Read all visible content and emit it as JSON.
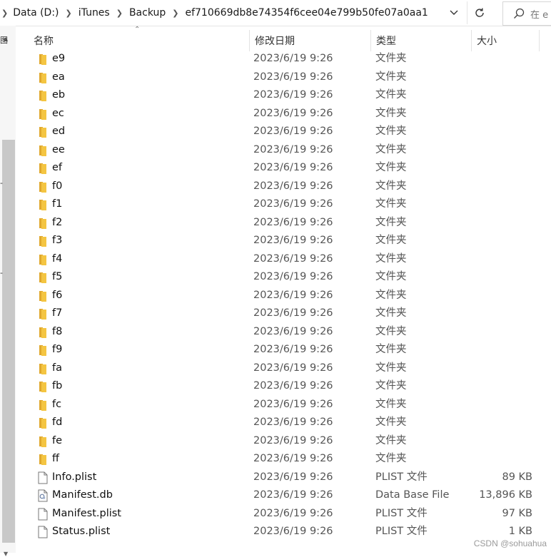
{
  "breadcrumb": {
    "items": [
      "Data (D:)",
      "iTunes",
      "Backup",
      "ef710669db8e74354f6cee04e799b50fe07a0aa1"
    ]
  },
  "search": {
    "placeholder": "在 e"
  },
  "left_pane": {
    "fragments": [
      "图",
      "...",
      "-"
    ]
  },
  "columns": {
    "name": "名称",
    "date": "修改日期",
    "type": "类型",
    "size": "大小"
  },
  "files": [
    {
      "name": "e9",
      "date": "2023/6/19 9:26",
      "type": "文件夹",
      "size": "",
      "icon": "folder-icon"
    },
    {
      "name": "ea",
      "date": "2023/6/19 9:26",
      "type": "文件夹",
      "size": "",
      "icon": "folder-icon"
    },
    {
      "name": "eb",
      "date": "2023/6/19 9:26",
      "type": "文件夹",
      "size": "",
      "icon": "folder-icon"
    },
    {
      "name": "ec",
      "date": "2023/6/19 9:26",
      "type": "文件夹",
      "size": "",
      "icon": "folder-icon"
    },
    {
      "name": "ed",
      "date": "2023/6/19 9:26",
      "type": "文件夹",
      "size": "",
      "icon": "folder-icon"
    },
    {
      "name": "ee",
      "date": "2023/6/19 9:26",
      "type": "文件夹",
      "size": "",
      "icon": "folder-icon"
    },
    {
      "name": "ef",
      "date": "2023/6/19 9:26",
      "type": "文件夹",
      "size": "",
      "icon": "folder-icon"
    },
    {
      "name": "f0",
      "date": "2023/6/19 9:26",
      "type": "文件夹",
      "size": "",
      "icon": "folder-icon"
    },
    {
      "name": "f1",
      "date": "2023/6/19 9:26",
      "type": "文件夹",
      "size": "",
      "icon": "folder-icon"
    },
    {
      "name": "f2",
      "date": "2023/6/19 9:26",
      "type": "文件夹",
      "size": "",
      "icon": "folder-icon"
    },
    {
      "name": "f3",
      "date": "2023/6/19 9:26",
      "type": "文件夹",
      "size": "",
      "icon": "folder-icon"
    },
    {
      "name": "f4",
      "date": "2023/6/19 9:26",
      "type": "文件夹",
      "size": "",
      "icon": "folder-icon"
    },
    {
      "name": "f5",
      "date": "2023/6/19 9:26",
      "type": "文件夹",
      "size": "",
      "icon": "folder-icon"
    },
    {
      "name": "f6",
      "date": "2023/6/19 9:26",
      "type": "文件夹",
      "size": "",
      "icon": "folder-icon"
    },
    {
      "name": "f7",
      "date": "2023/6/19 9:26",
      "type": "文件夹",
      "size": "",
      "icon": "folder-icon"
    },
    {
      "name": "f8",
      "date": "2023/6/19 9:26",
      "type": "文件夹",
      "size": "",
      "icon": "folder-icon"
    },
    {
      "name": "f9",
      "date": "2023/6/19 9:26",
      "type": "文件夹",
      "size": "",
      "icon": "folder-icon"
    },
    {
      "name": "fa",
      "date": "2023/6/19 9:26",
      "type": "文件夹",
      "size": "",
      "icon": "folder-icon"
    },
    {
      "name": "fb",
      "date": "2023/6/19 9:26",
      "type": "文件夹",
      "size": "",
      "icon": "folder-icon"
    },
    {
      "name": "fc",
      "date": "2023/6/19 9:26",
      "type": "文件夹",
      "size": "",
      "icon": "folder-icon"
    },
    {
      "name": "fd",
      "date": "2023/6/19 9:26",
      "type": "文件夹",
      "size": "",
      "icon": "folder-icon"
    },
    {
      "name": "fe",
      "date": "2023/6/19 9:26",
      "type": "文件夹",
      "size": "",
      "icon": "folder-icon"
    },
    {
      "name": "ff",
      "date": "2023/6/19 9:26",
      "type": "文件夹",
      "size": "",
      "icon": "folder-icon"
    },
    {
      "name": "Info.plist",
      "date": "2023/6/19 9:26",
      "type": "PLIST 文件",
      "size": "89 KB",
      "icon": "file-icon"
    },
    {
      "name": "Manifest.db",
      "date": "2023/6/19 9:26",
      "type": "Data Base File",
      "size": "13,896 KB",
      "icon": "database-file-icon"
    },
    {
      "name": "Manifest.plist",
      "date": "2023/6/19 9:26",
      "type": "PLIST 文件",
      "size": "97 KB",
      "icon": "file-icon"
    },
    {
      "name": "Status.plist",
      "date": "2023/6/19 9:26",
      "type": "PLIST 文件",
      "size": "1 KB",
      "icon": "file-icon"
    }
  ],
  "watermark": "CSDN @sohuahua",
  "colors": {
    "folder": "#f4c542",
    "folder_dark": "#e0a82e",
    "text": "#111111",
    "muted": "#555555"
  }
}
